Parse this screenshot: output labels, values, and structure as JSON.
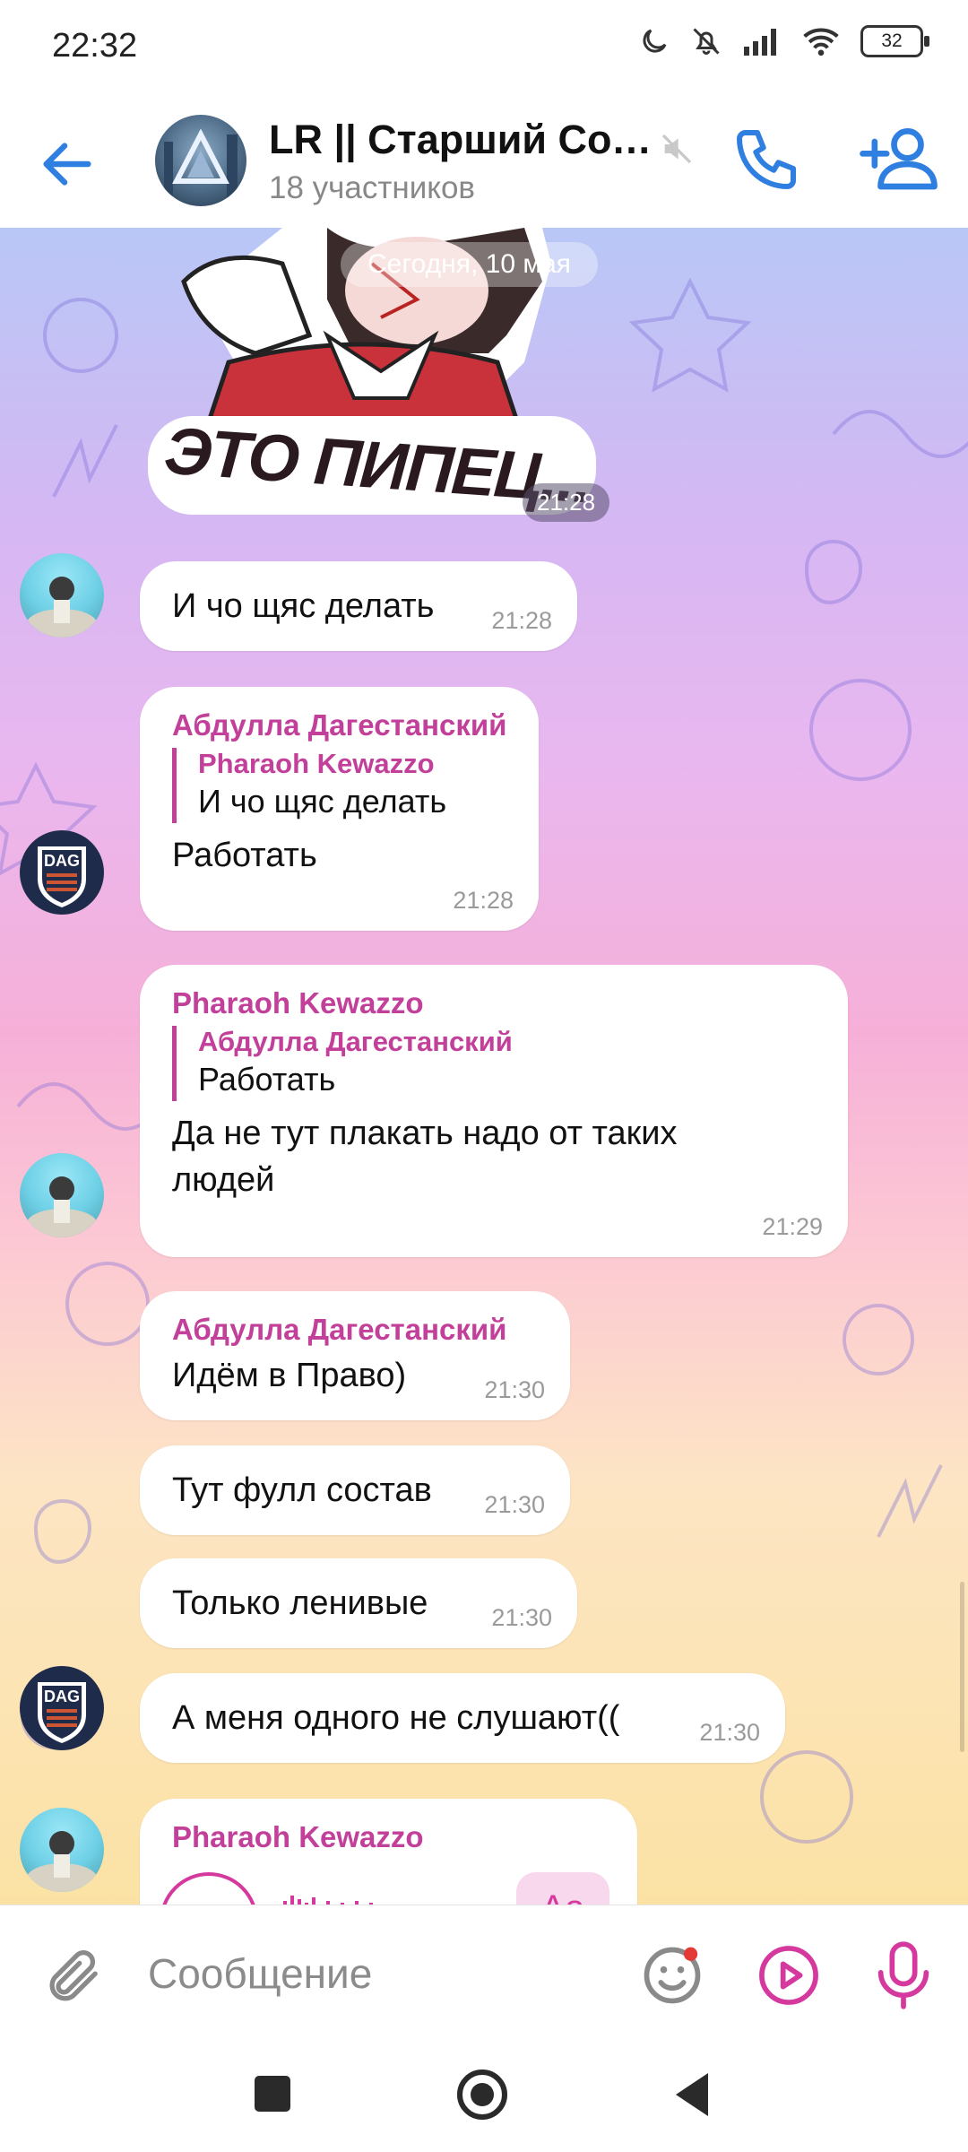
{
  "status_bar": {
    "time": "22:32",
    "battery": "32"
  },
  "header": {
    "title": "LR || Старший Сос...",
    "subtitle": "18 участников"
  },
  "chat": {
    "date_pill": "Сегодня, 10 мая",
    "sticker": {
      "caption": "ЭТО ПИПЕЦ...",
      "time": "21:28"
    },
    "messages": [
      {
        "text": "И чо щяс делать",
        "time": "21:28"
      },
      {
        "sender": "Абдулла Дагестанский",
        "reply_name": "Pharaoh Kewazzo",
        "reply_text": "И чо щяс делать",
        "text": "Работать",
        "time": "21:28"
      },
      {
        "sender": "Pharaoh Kewazzo",
        "reply_name": "Абдулла Дагестанский",
        "reply_text": "Работать",
        "text": "Да не тут плакать надо от таких людей",
        "time": "21:29"
      },
      {
        "sender": "Абдулла Дагестанский",
        "text": "Идём в Право)",
        "time": "21:30"
      },
      {
        "text": "Тут фулл состав",
        "time": "21:30"
      },
      {
        "text": "Только ленивые",
        "time": "21:30"
      },
      {
        "text": "А меня одного не слушают((",
        "time": "21:30"
      },
      {
        "sender": "Pharaoh Kewazzo",
        "voice_badge": "Aa"
      }
    ]
  },
  "input": {
    "placeholder": "Сообщение"
  },
  "colors": {
    "accent": "#2f7fe0",
    "sender": "#c2409a",
    "icon_pink": "#d6399e"
  }
}
